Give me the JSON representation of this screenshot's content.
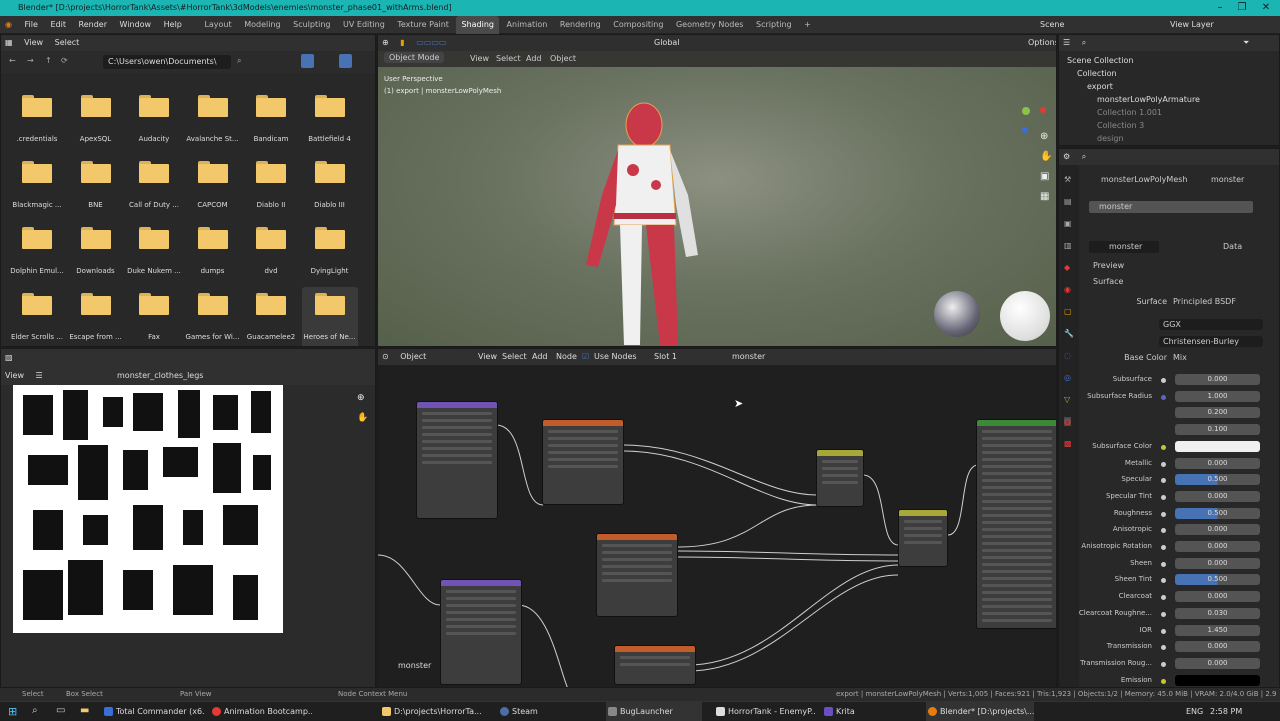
{
  "window": {
    "title": "Blender* [D:\\projects\\HorrorTank\\Assets\\#HorrorTank\\3dModels\\enemies\\monster_phase01_withArms.blend]"
  },
  "menu": [
    "File",
    "Edit",
    "Render",
    "Window",
    "Help"
  ],
  "workspaces": [
    "Layout",
    "Modeling",
    "Sculpting",
    "UV Editing",
    "Texture Paint",
    "Shading",
    "Animation",
    "Rendering",
    "Compositing",
    "Geometry Nodes",
    "Scripting"
  ],
  "active_workspace": "Shading",
  "scene_name": "Scene",
  "view_layer": "View Layer",
  "file_browser": {
    "header": [
      "View",
      "Select"
    ],
    "path": "C:\\Users\\owen\\Documents\\",
    "folders": [
      ".credentials",
      "ApexSQL",
      "Audacity",
      "Avalanche St...",
      "Bandicam",
      "Battlefield 4",
      "Blackmagic ...",
      "BNE",
      "Call of Duty ...",
      "CAPCOM",
      "Diablo II",
      "Diablo III",
      "Dolphin Emul...",
      "Downloads",
      "Duke Nukem ...",
      "dumps",
      "dvd",
      "DyingLight",
      "Elder Scrolls ...",
      "Escape from ...",
      "Fax",
      "Games for Wi...",
      "Guacamelee2",
      "Heroes of Ne..."
    ]
  },
  "viewport": {
    "header": [
      "Object Mode",
      "View",
      "Select",
      "Add",
      "Object"
    ],
    "transform": "Global",
    "options": "Options",
    "perspective": "User Perspective",
    "object_info": "(1) export | monsterLowPolyMesh"
  },
  "image_editor": {
    "header": [
      "View"
    ],
    "image_name": "monster_clothes_legs"
  },
  "node_editor": {
    "header": [
      "Object",
      "View",
      "Select",
      "Add",
      "Node"
    ],
    "use_nodes": "Use Nodes",
    "slot": "Slot 1",
    "material": "monster",
    "label": "monster"
  },
  "outliner": {
    "items": [
      "Scene Collection",
      "Collection",
      "export",
      "monsterLowPolyArmature",
      "Collection 1.001",
      "Collection 3",
      "design"
    ]
  },
  "properties": {
    "object_name": "monsterLowPolyMesh",
    "material_name": "monster",
    "slot": "monster",
    "data_label": "Data",
    "sections": [
      "Preview",
      "Surface"
    ],
    "surface": "Principled BSDF",
    "distribution": "GGX",
    "subsurface_method": "Christensen-Burley",
    "base_color": "Mix",
    "rows": [
      {
        "label": "Subsurface",
        "value": "0.000"
      },
      {
        "label": "Subsurface Radius",
        "value": "1.000"
      },
      {
        "label": "",
        "value": "0.200"
      },
      {
        "label": "",
        "value": "0.100"
      },
      {
        "label": "Subsurface Color",
        "value": ""
      },
      {
        "label": "Metallic",
        "value": "0.000"
      },
      {
        "label": "Specular",
        "value": "0.500"
      },
      {
        "label": "Specular Tint",
        "value": "0.000"
      },
      {
        "label": "Roughness",
        "value": "0.500"
      },
      {
        "label": "Anisotropic",
        "value": "0.000"
      },
      {
        "label": "Anisotropic Rotation",
        "value": "0.000"
      },
      {
        "label": "Sheen",
        "value": "0.000"
      },
      {
        "label": "Sheen Tint",
        "value": "0.500"
      },
      {
        "label": "Clearcoat",
        "value": "0.000"
      },
      {
        "label": "Clearcoat Roughne...",
        "value": "0.030"
      },
      {
        "label": "IOR",
        "value": "1.450"
      },
      {
        "label": "Transmission",
        "value": "0.000"
      },
      {
        "label": "Transmission Roug...",
        "value": "0.000"
      },
      {
        "label": "Emission",
        "value": ""
      }
    ]
  },
  "status_bar": {
    "left": [
      "Select",
      "Box Select",
      "Pan View",
      "Node Context Menu"
    ],
    "right": "export | monsterLowPolyMesh | Verts:1,005 | Faces:921 | Tris:1,923 | Objects:1/2 | Memory: 45.0 MiB | VRAM: 2.0/4.0 GiB | 2.93.7"
  },
  "taskbar": {
    "apps": [
      "Total Commander (x6...",
      "Animation Bootcamp...",
      "D:\\projects\\HorrorTa...",
      "Steam",
      "BugLauncher",
      "HorrorTank - EnemyP...",
      "Krita",
      "Blender* [D:\\projects\\..."
    ],
    "time": "2:58 PM",
    "lang": "ENG"
  }
}
